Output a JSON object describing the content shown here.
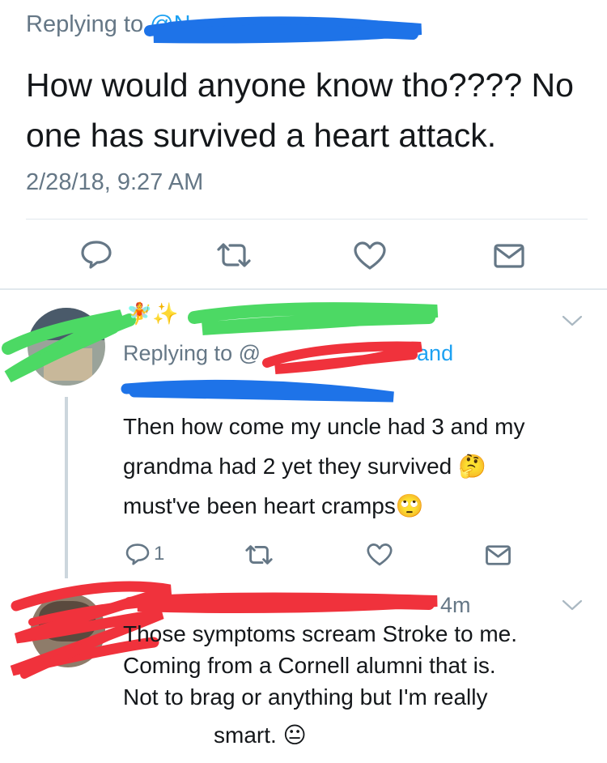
{
  "main_tweet": {
    "replying_prefix": "Replying to",
    "handle_fragment": "@N",
    "text_line1": "How would anyone know tho???? No",
    "text_line2": "one has survived a heart attack.",
    "timestamp": "2/28/18, 9:27 AM"
  },
  "action_icons": {
    "reply": "reply-icon",
    "retweet": "retweet-icon",
    "like": "heart-icon",
    "dm": "envelope-icon"
  },
  "reply1": {
    "name_emoji": "🧚✨",
    "replying_prefix": "Replying to @",
    "replying_suffix": "and",
    "text_line1": "Then how come my uncle had 3 and my",
    "text_line2": "grandma had 2 yet they survived 🤔",
    "text_line3": "must've been heart cramps🙄",
    "reply_count": "1"
  },
  "reply2": {
    "time_ago": "4m",
    "text_line1": "Those symptoms scream Stroke to me.",
    "text_line2": "Coming from a Cornell alumni that is.",
    "text_line3": "Not to brag or anything but I'm really",
    "text_line4": "smart. 😐"
  },
  "colors": {
    "twitter_blue": "#1da1f2",
    "muted_gray": "#657786",
    "redaction_blue": "#1e73e8",
    "redaction_green": "#4cd964",
    "redaction_red": "#f0323c"
  }
}
